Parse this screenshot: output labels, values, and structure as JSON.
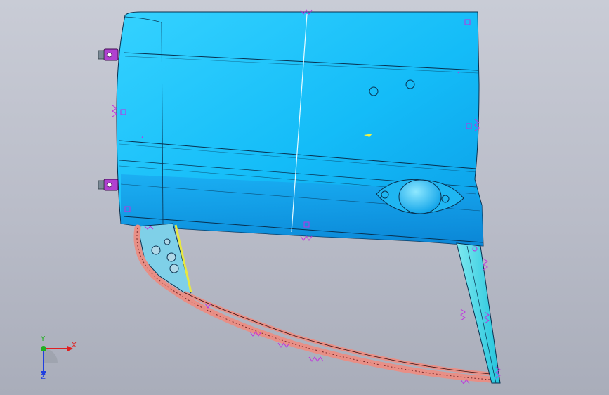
{
  "viewport": {
    "background_top": "#c9ccd6",
    "background_bottom": "#a9adba"
  },
  "model": {
    "panel_color": "#1ec8ff",
    "panel_shade": "#0aa6ec",
    "frame_color": "#3ad7e6",
    "seal_color": "#e88f86",
    "constraint_color": "#b030d0",
    "edge_color": "#0a2a50"
  },
  "triad": {
    "x_label": "X",
    "y_label": "Y",
    "z_label": "Z",
    "x_color": "#e02020",
    "y_color": "#20b020",
    "z_color": "#2040e0"
  }
}
